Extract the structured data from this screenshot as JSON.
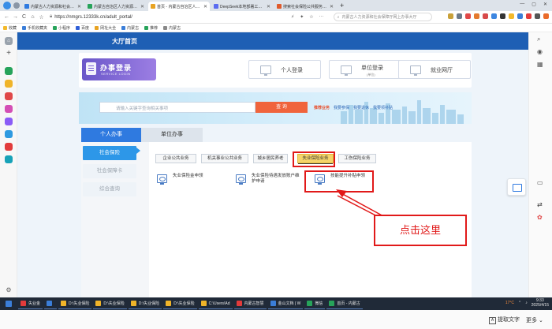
{
  "browser": {
    "tabs": [
      {
        "title": "内蒙古人力资源和社会保障厅",
        "color": "#2f7ae0",
        "active": false
      },
      {
        "title": "内蒙古自治区人力资源和社会",
        "color": "#27a35a",
        "active": false
      },
      {
        "title": "首页 - 内蒙古自治区人力资源",
        "color": "#e8a322",
        "active": true
      },
      {
        "title": "DeepSeek本地部署工具 - 后",
        "color": "#5b6cf0",
        "active": false
      },
      {
        "title": "搜索社会保险公共服务平台",
        "color": "#e05a2b",
        "active": false
      }
    ],
    "new_tab": "+",
    "window_controls": [
      "—",
      "▢",
      "✕"
    ],
    "url": "https://nmgrs.12333k.cn/adult_portal/",
    "search_placeholder": "内蒙古人力资源和社会保障厅网上办事大厅",
    "bookmarks": [
      "收藏",
      "手机收藏夹",
      "小程序",
      "百度",
      "网址大全",
      "内蒙古",
      "推荐",
      "内蒙古"
    ]
  },
  "page": {
    "header_title": "大厅首页",
    "logo_main": "办事登录",
    "logo_sub": "SERVICE LOGIN",
    "login_buttons": [
      {
        "label": "个人登录",
        "sub": ""
      },
      {
        "label": "单位登录",
        "sub": "(单位)"
      },
      {
        "label": "就业网厅",
        "sub": ""
      }
    ],
    "search_placeholder": "请输入关键字查询相关事项",
    "search_button": "查 询",
    "recommend_head": "推荐业务",
    "recommend_items": [
      "我要参保",
      "我要退休",
      "我要领补贴"
    ],
    "tabs": [
      "个人办事",
      "单位办事"
    ],
    "left_nav": [
      "社会保险",
      "社会保障卡",
      "综合查询"
    ],
    "categories": [
      "企业公共业务",
      "机关事业公共业务",
      "城乡居民养老",
      "失业保险业务",
      "工伤保险业务"
    ],
    "selected_category": "失业保险业务",
    "services": [
      "失业保险金申领",
      "失业保险待遇发放账户维护申请",
      "技能提升补贴申领"
    ]
  },
  "annotation": {
    "callout": "点击这里",
    "color": "#e11919"
  },
  "taskbar": {
    "items": [
      "失业金",
      "D:\\失业保险",
      "D:\\失业保险",
      "D:\\失业保险",
      "D:\\失业保险",
      "C:\\Users\\Ad",
      "内蒙古智慧",
      "金山文档 | W",
      "微信",
      "首页 - 内蒙古"
    ],
    "clock_time": "9:33",
    "clock_date": "2025/4/15",
    "temp": "17°C"
  },
  "bottom": {
    "ocr_label": "提取文字",
    "more_label": "更多"
  }
}
